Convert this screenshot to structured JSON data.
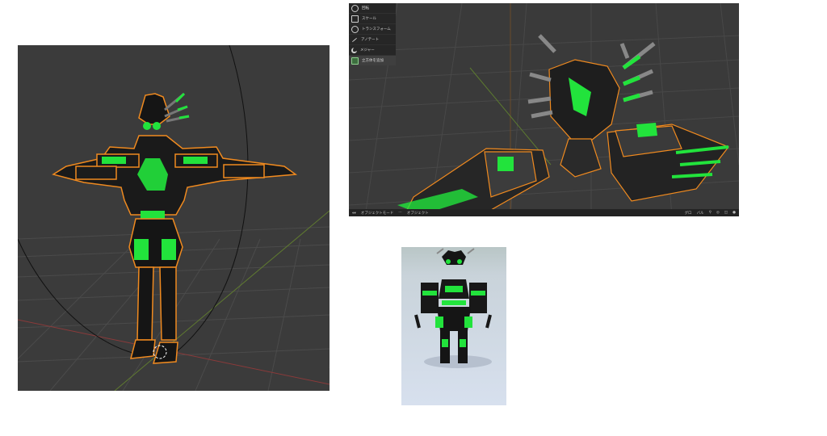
{
  "right_viewport": {
    "toolbar": [
      {
        "label": "回転",
        "icon": "rotate-icon"
      },
      {
        "label": "スケール",
        "icon": "scale-icon"
      },
      {
        "label": "トランスフォーム",
        "icon": "transform-icon"
      },
      {
        "label": "アノテート",
        "icon": "annotate-icon"
      },
      {
        "label": "メジャー",
        "icon": "measure-icon"
      },
      {
        "label": "立方体を追加",
        "icon": "add-cube-icon"
      }
    ],
    "statusbar": {
      "mode": "オブジェクトモード",
      "object_label": "オブジェクト",
      "pivot_label": "グロ",
      "pivot_short": "バル"
    }
  },
  "colors": {
    "viewport_bg": "#3b3b3b",
    "grid": "#4a4a4a",
    "accent_green": "#22e33c",
    "outline_orange": "#f08a1f",
    "armor_black": "#151515",
    "preview_bg": "#d7e0ee"
  }
}
